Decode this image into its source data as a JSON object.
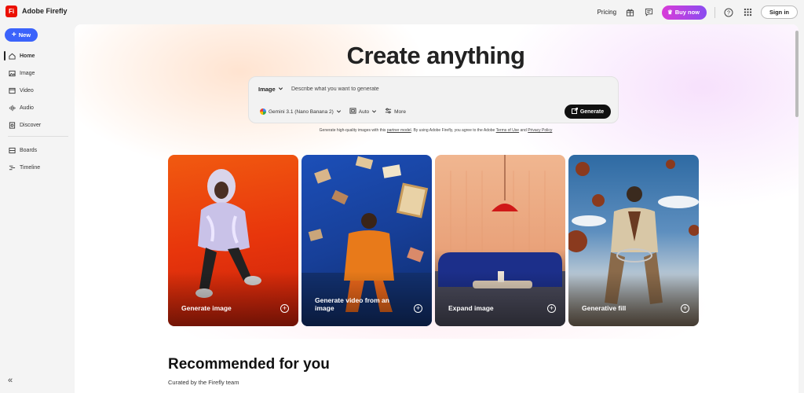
{
  "app": {
    "logo_text": "Fi",
    "name": "Adobe Firefly"
  },
  "topbar": {
    "pricing": "Pricing",
    "buy_now": "Buy now",
    "sign_in": "Sign in",
    "icons": [
      "gift-icon",
      "chat-icon",
      "help-icon",
      "apps-grid-icon"
    ]
  },
  "sidebar": {
    "new_label": "New",
    "items": [
      {
        "label": "Home",
        "icon": "home-icon",
        "active": true
      },
      {
        "label": "Image",
        "icon": "image-icon"
      },
      {
        "label": "Video",
        "icon": "video-icon"
      },
      {
        "label": "Audio",
        "icon": "audio-icon"
      },
      {
        "label": "Discover",
        "icon": "discover-icon"
      },
      {
        "label": "Boards",
        "icon": "boards-icon"
      },
      {
        "label": "Timeline",
        "icon": "timeline-icon"
      }
    ]
  },
  "hero": {
    "title": "Create anything",
    "mode": "Image",
    "placeholder": "Describe what you want to generate",
    "model": "Gemini 3.1 (Nano Banana 2)",
    "aspect": "Auto",
    "more": "More",
    "generate": "Generate",
    "legal_1": "Generate high-quality images with this",
    "legal_link_1": "partner model",
    "legal_2": ". By using Adobe Firefly, you agree to the Adobe",
    "legal_link_2": "Terms of Use",
    "legal_3": "and",
    "legal_link_3": "Privacy Policy"
  },
  "cards": [
    {
      "label": "Generate image"
    },
    {
      "label": "Generate video from an image"
    },
    {
      "label": "Expand image"
    },
    {
      "label": "Generative fill"
    }
  ],
  "recommended": {
    "title": "Recommended for you",
    "subtitle": "Curated by the Firefly team"
  }
}
